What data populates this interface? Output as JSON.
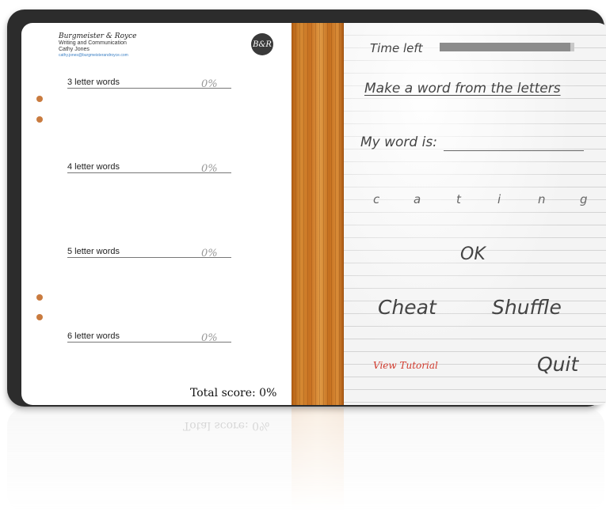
{
  "app": {
    "brand_name": "Burgmeister & Royce",
    "brand_subtitle": "Writing and Communication",
    "user_name": "Cathy Jones",
    "user_email": "cathy.jones@burgmeisterandroyce.com",
    "logo_text": "B&R"
  },
  "scoreboard": {
    "rows": [
      {
        "label": "3 letter words",
        "percent": "0%"
      },
      {
        "label": "4 letter words",
        "percent": "0%"
      },
      {
        "label": "5 letter words",
        "percent": "0%"
      },
      {
        "label": "6 letter words",
        "percent": "0%"
      }
    ],
    "total_label": "Total score: 0%"
  },
  "game": {
    "time_label": "Time left",
    "time_remaining_fraction": 0.97,
    "instruction": "Make a word from the letters",
    "my_word_label": "My word is:",
    "letters": [
      "c",
      "a",
      "t",
      "i",
      "n",
      "g"
    ],
    "ok_label": "OK",
    "cheat_label": "Cheat",
    "shuffle_label": "Shuffle",
    "tutorial_label": "View Tutorial",
    "quit_label": "Quit"
  },
  "colors": {
    "frame": "#2c2c2c",
    "hole": "#c97b3f",
    "wood": "#d58a33",
    "tutorial_text": "#d23b2e"
  }
}
